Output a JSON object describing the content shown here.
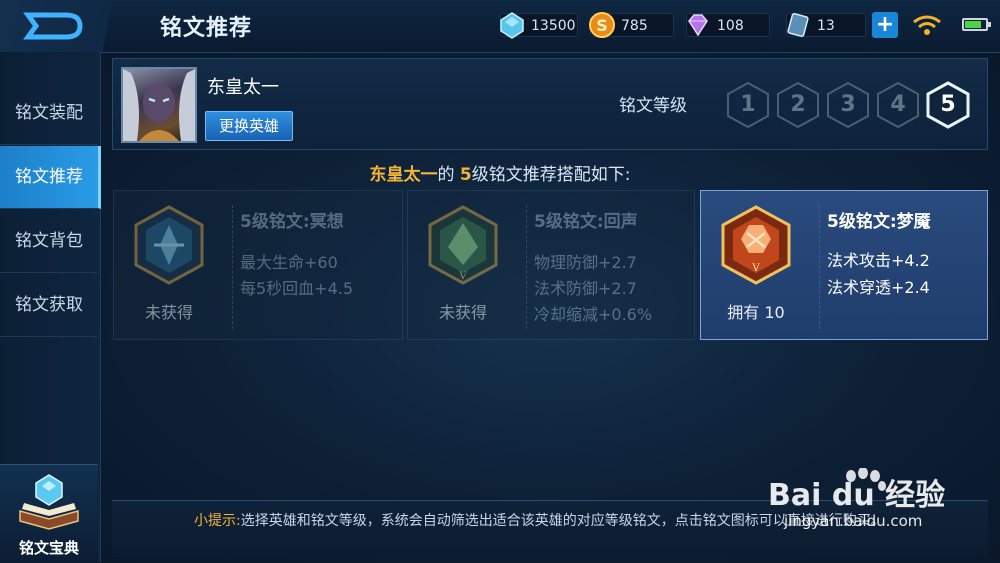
{
  "header": {
    "title": "铭文推荐",
    "resources": [
      {
        "name": "diamond",
        "icon": "blue-crystal-icon",
        "value": "13500"
      },
      {
        "name": "gold",
        "icon": "gold-coin-icon",
        "value": "785"
      },
      {
        "name": "gem",
        "icon": "purple-gem-icon",
        "value": "108"
      },
      {
        "name": "ticket",
        "icon": "blue-ticket-icon",
        "value": "13"
      }
    ],
    "plus": "+"
  },
  "sidebar": {
    "items": [
      {
        "label": "铭文装配"
      },
      {
        "label": "铭文推荐"
      },
      {
        "label": "铭文背包"
      },
      {
        "label": "铭文获取"
      }
    ],
    "book_label": "铭文宝典"
  },
  "hero": {
    "name": "东皇太一",
    "change_button": "更换英雄",
    "level_label": "铭文等级",
    "levels": [
      "1",
      "2",
      "3",
      "4",
      "5"
    ],
    "selected_level": "5"
  },
  "recommend": {
    "hero": "东皇太一",
    "part1": "的 ",
    "level": "5",
    "part2": "级铭文推荐搭配如下:"
  },
  "cards": [
    {
      "name": "5级铭文:冥想",
      "status": "未获得",
      "attrs": [
        "最大生命+60",
        "每5秒回血+4.5"
      ]
    },
    {
      "name": "5级铭文:回声",
      "status": "未获得",
      "attrs": [
        "物理防御+2.7",
        "法术防御+2.7",
        "冷却缩减+0.6%"
      ]
    },
    {
      "name": "5级铭文:梦魇",
      "status": "拥有 10",
      "attrs": [
        "法术攻击+4.2",
        "法术穿透+2.4"
      ]
    }
  ],
  "tip": {
    "label": "小提示:",
    "text": "选择英雄和铭文等级，系统会自动筛选出适合该英雄的对应等级铭文，点击铭文图标可以直接进行购买。"
  },
  "watermark": {
    "brand": "Bai du 经验",
    "url": "jingyan.baidu.com"
  }
}
